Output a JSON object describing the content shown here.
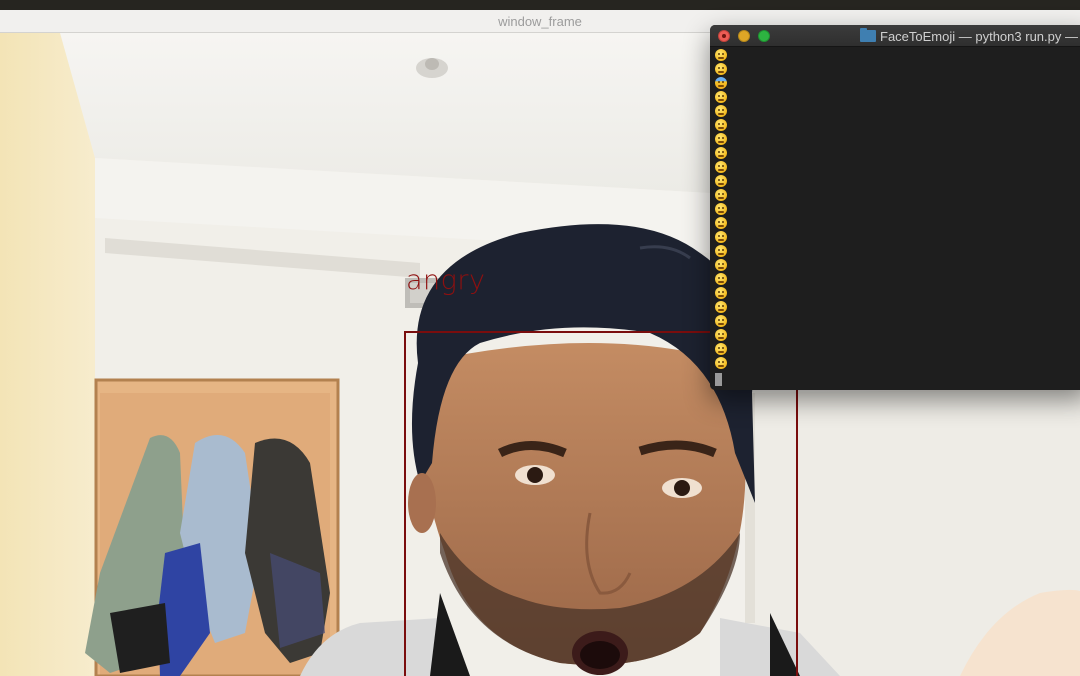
{
  "camera_window": {
    "title": "window_frame",
    "detection": {
      "label": "angry"
    }
  },
  "terminal": {
    "title": "FaceToEmoji — python3 run.py —",
    "icons": {
      "folder": "folder-icon",
      "emoji": "emoji-icon"
    },
    "emoji_output": [
      "angry",
      "confused",
      "fearful",
      "angry",
      "confused",
      "confused",
      "angry",
      "angry",
      "angry",
      "confused",
      "angry",
      "angry",
      "angry",
      "angry",
      "confused",
      "angry",
      "angry",
      "confused",
      "angry",
      "angry",
      "angry",
      "angry",
      "angry"
    ]
  },
  "colors": {
    "box": "#7a0d0d",
    "label": "#8e1010",
    "terminal_bg": "#1e1e1e"
  }
}
